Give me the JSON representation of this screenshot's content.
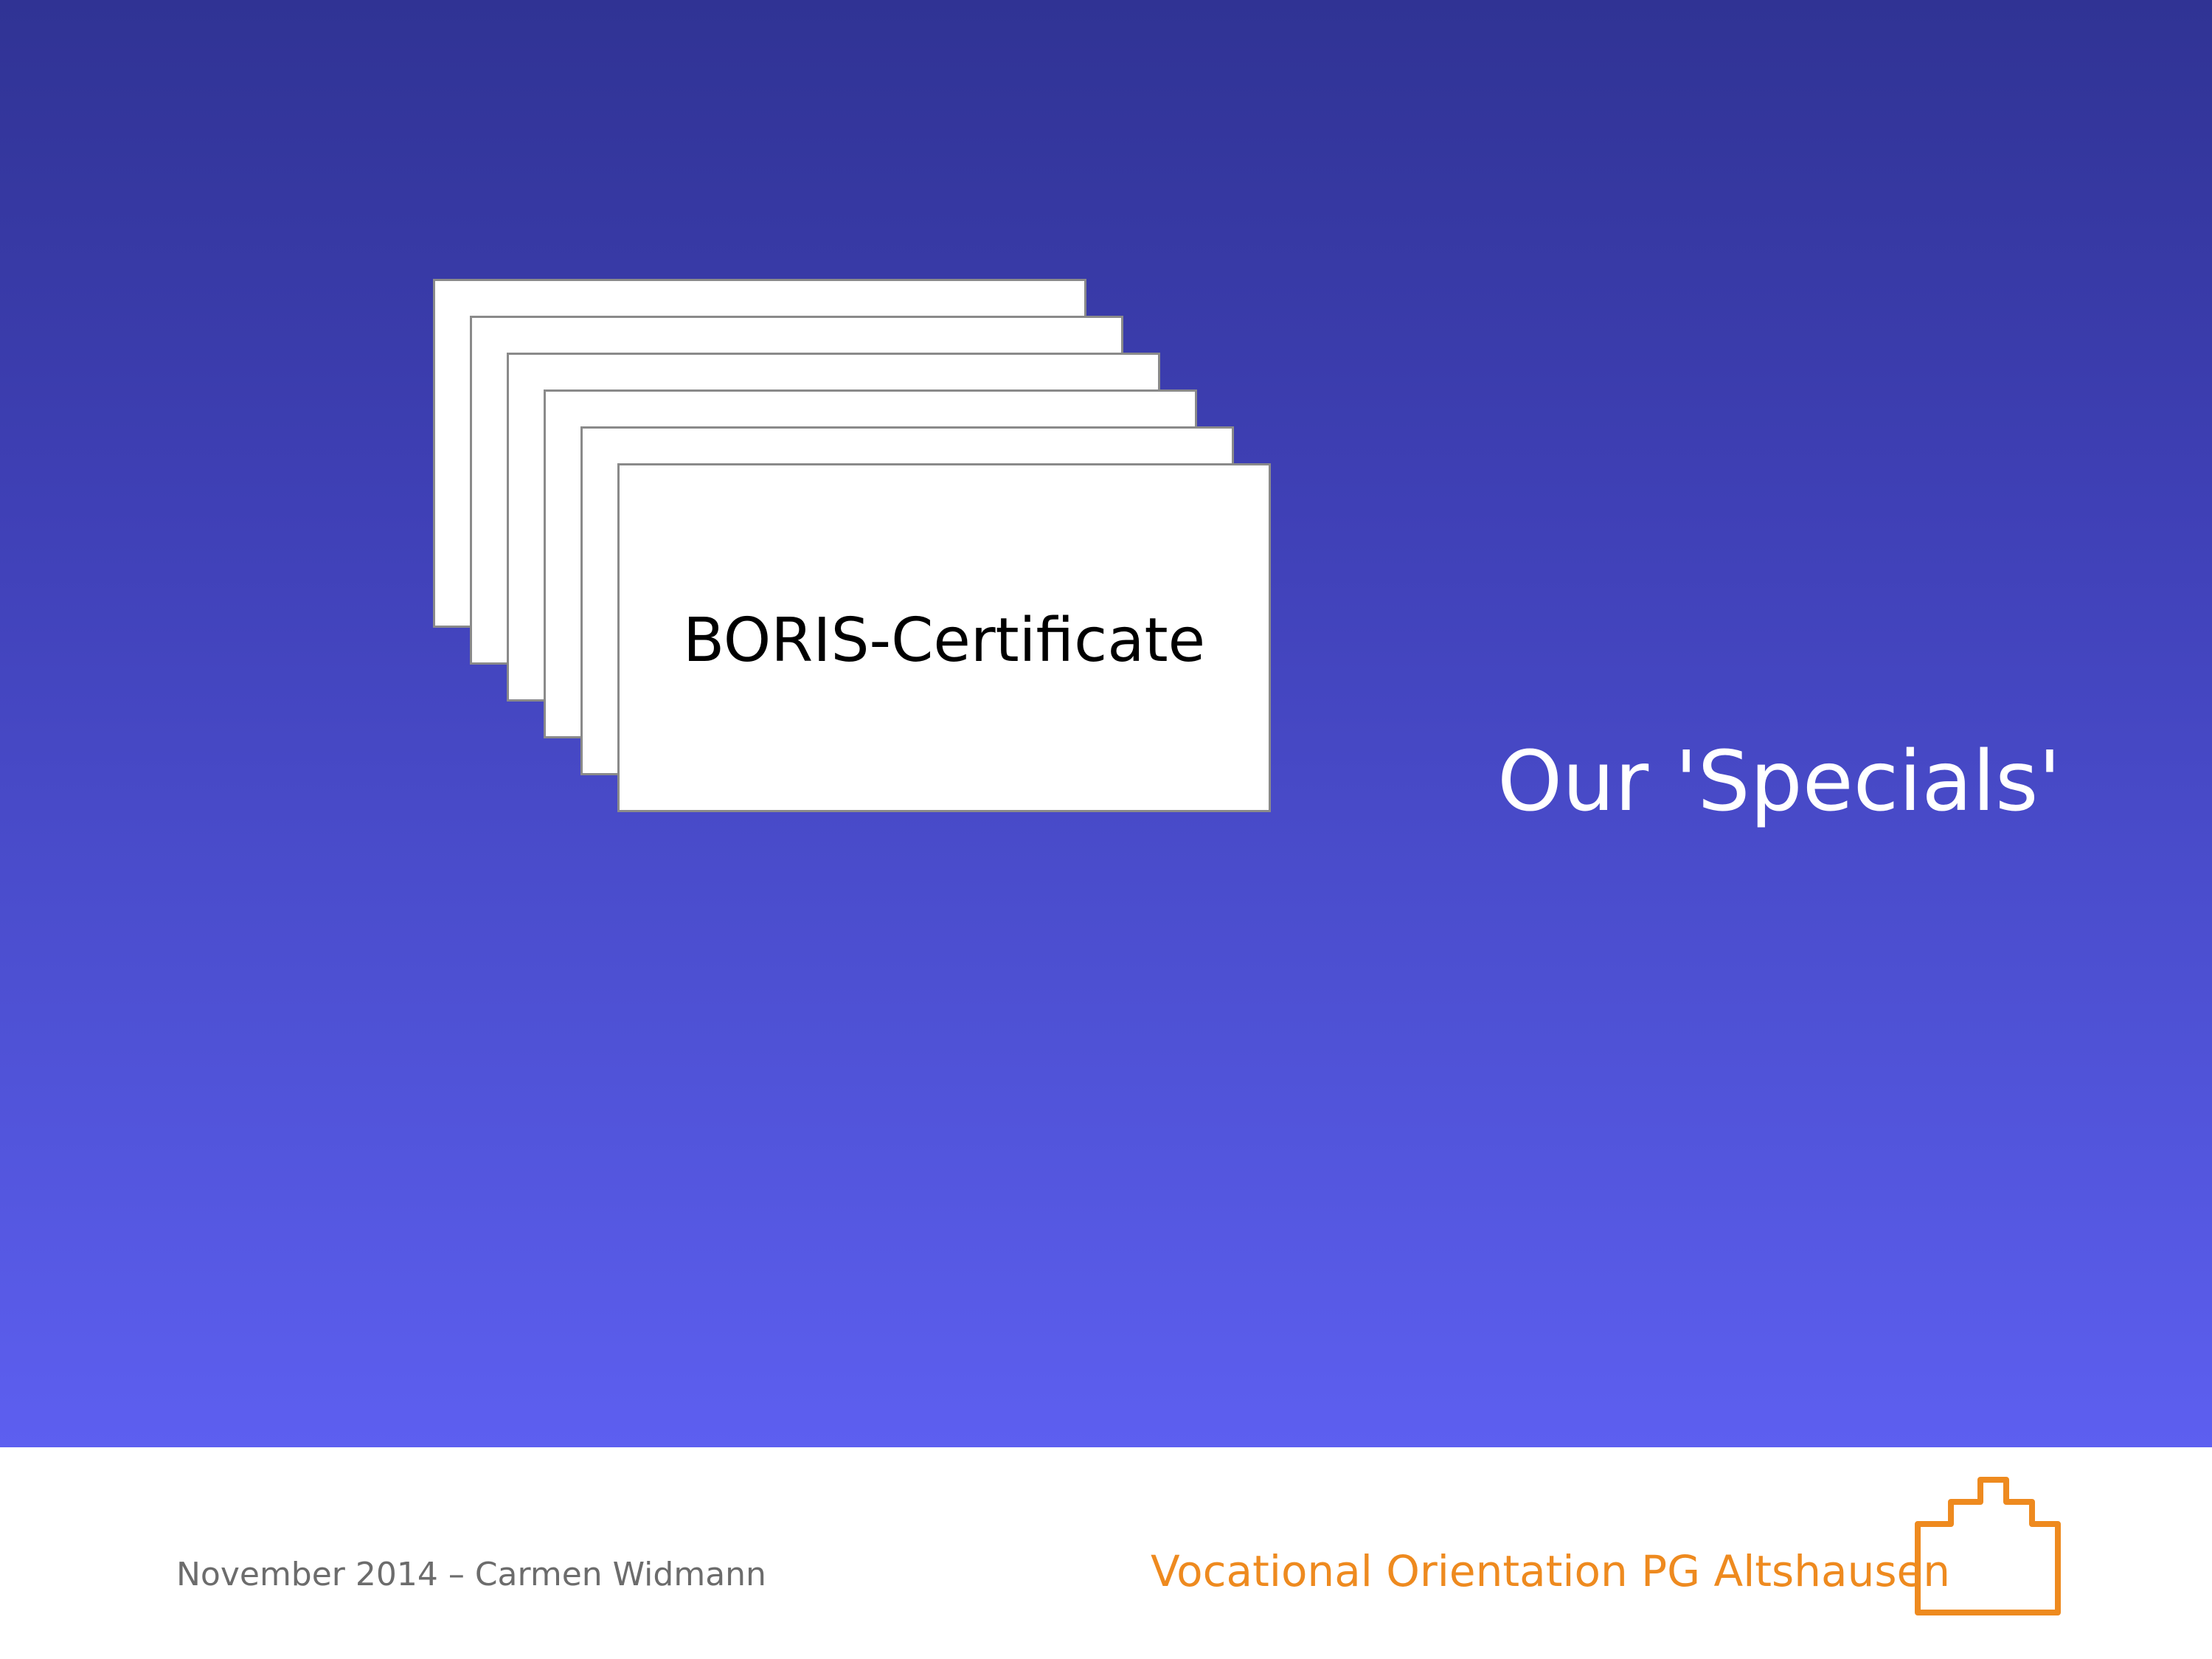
{
  "slide": {
    "card_label": "BORIS-Certificate",
    "title": "Our 'Specials'"
  },
  "footer": {
    "date_author": "November 2014  – Carmen Widmann",
    "program": "Vocational Orientation PG Altshausen"
  },
  "icons": {
    "logo": "building-outline-icon"
  },
  "colors": {
    "background_top": "#303394",
    "background_bottom": "#5d5ff0",
    "accent_orange": "#ee8a1f",
    "card_border": "#8a8a8a",
    "footer_text": "#6c6c6c"
  }
}
